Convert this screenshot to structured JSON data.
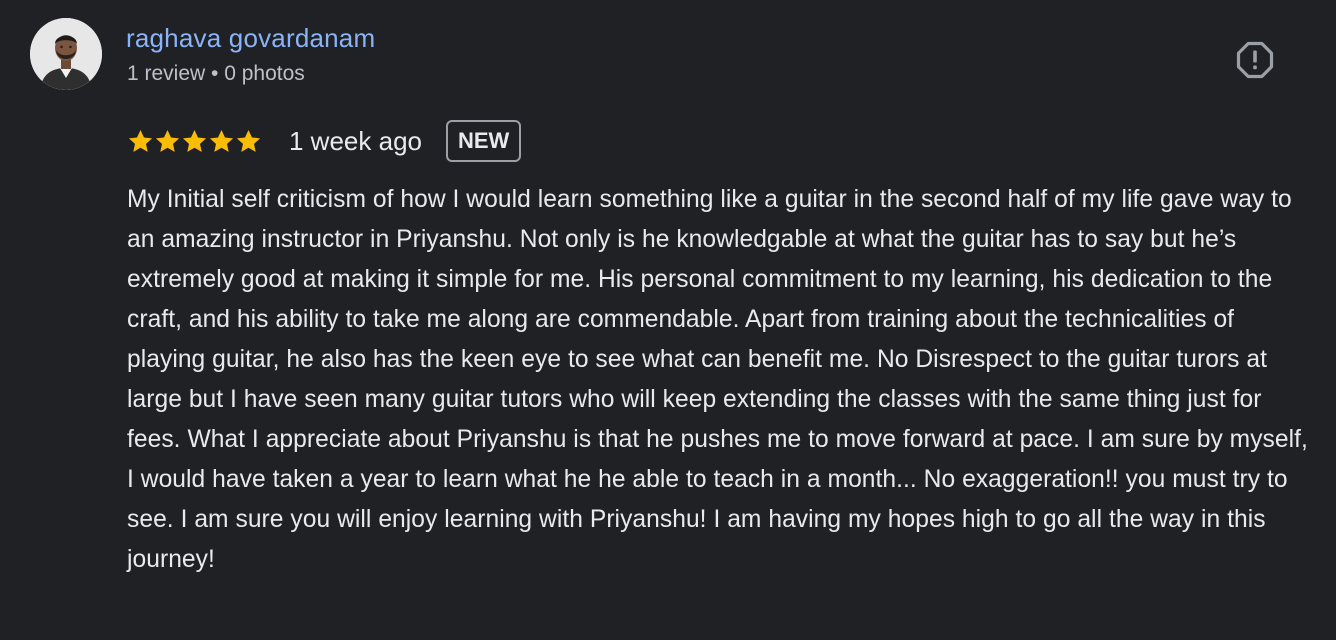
{
  "review": {
    "author": {
      "name": "raghava govardanam",
      "meta": "1 review • 0 photos",
      "avatar_icon": "person-avatar"
    },
    "rating": {
      "stars": 5,
      "max": 5,
      "star_color": "#fbbc04"
    },
    "date": "1 week ago",
    "badge": "NEW",
    "report_icon": "report-icon",
    "text": "My Initial self criticism of how I would learn something like a guitar in the second half of my life gave way to an amazing instructor in Priyanshu. Not only is he knowledgable at what the guitar has to say but he’s extremely good at making it simple for me. His personal commitment to my learning, his dedication to the craft, and his ability to take me along are commendable. Apart from training about the technicalities of playing guitar, he also has the keen eye to see what can benefit me. No Disrespect to the guitar turors at large but I have seen many guitar tutors who will keep extending the classes with the same thing just for fees. What I appreciate about Priyanshu is that he pushes me to move forward at pace. I am sure by myself, I would have taken a year to learn what he he able to teach in a month... No exaggeration!! you must try to see. I am sure you will enjoy learning with Priyanshu! I am having my hopes high to go all the way in this journey!"
  },
  "colors": {
    "background": "#202124",
    "author_link": "#8ab4f8",
    "secondary_text": "#bdc1c6",
    "primary_text": "#e8eaed",
    "icon_gray": "#9aa0a6"
  }
}
